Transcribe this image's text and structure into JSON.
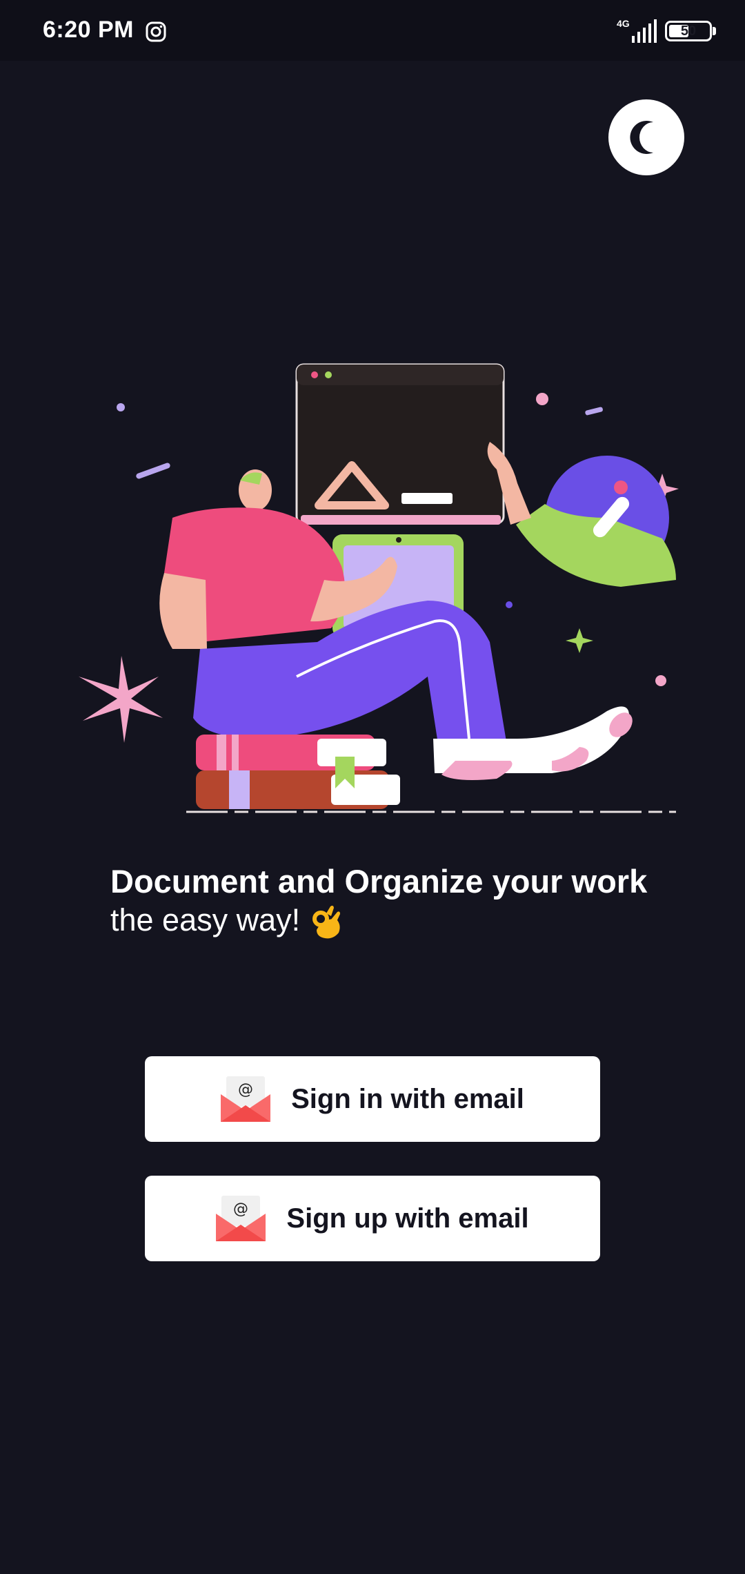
{
  "status_bar": {
    "time": "6:20 PM",
    "network_type": "4G",
    "battery_level": "50",
    "battery_fraction": 0.5
  },
  "theme_toggle": {
    "icon": "moon-icon"
  },
  "headline": {
    "title": "Document and Organize your work",
    "subtitle": "the easy way!",
    "emoji_icon": "ok-hand-icon"
  },
  "buttons": {
    "sign_in_label": "Sign in with email",
    "sign_up_label": "Sign up with email",
    "icon": "email-envelope-icon"
  },
  "colors": {
    "background": "#14141f",
    "status_bar": "#0f0f18",
    "button_background": "#ffffff",
    "button_text": "#14141f",
    "envelope": "#f96a6a"
  }
}
